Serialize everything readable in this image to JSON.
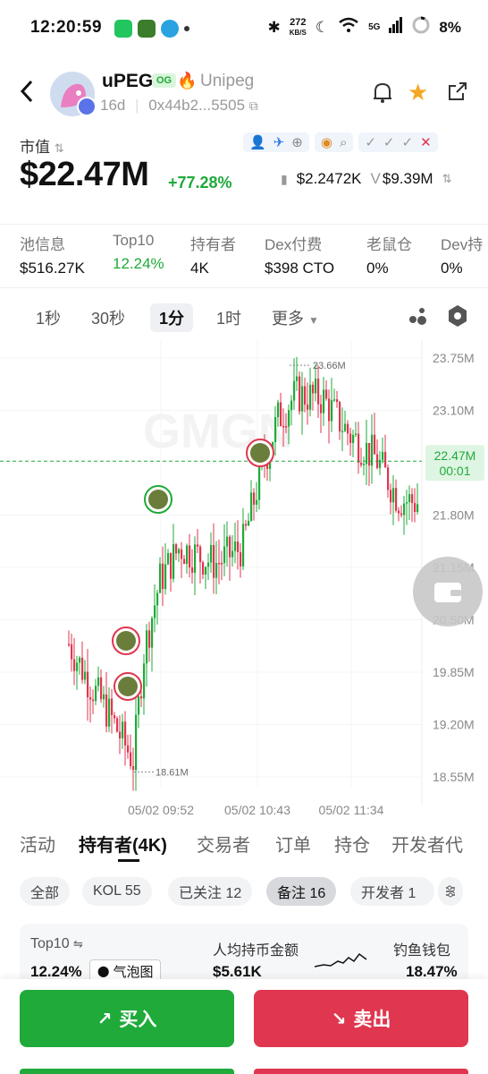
{
  "status": {
    "time": "12:20:59",
    "net_speed": "272",
    "net_unit": "KB/S",
    "battery": "8%",
    "net_type": "5G"
  },
  "header": {
    "name": "uPEG",
    "badge": "OG",
    "alias": "Unipeg",
    "age": "16d",
    "address": "0x44b2...5505"
  },
  "market": {
    "label": "市值",
    "value": "$22.47M",
    "change": "+77.28%",
    "price": "$2.2472K",
    "vol_prefix": "V",
    "volume": "$9.39M"
  },
  "stats": [
    {
      "label": "池信息",
      "value": "$516.27K"
    },
    {
      "label": "Top10",
      "value": "12.24%",
      "green": true
    },
    {
      "label": "持有者",
      "value": "4K"
    },
    {
      "label": "Dex付费",
      "value": "$398 CTO"
    },
    {
      "label": "老鼠仓",
      "value": "0%"
    },
    {
      "label": "Dev持",
      "value": "0%"
    }
  ],
  "timeframes": [
    "1秒",
    "30秒",
    "1分",
    "1时",
    "更多"
  ],
  "chart_data": {
    "type": "candlestick",
    "y_ticks": [
      "23.75M",
      "23.10M",
      "22.45M",
      "21.80M",
      "21.15M",
      "20.50M",
      "19.85M",
      "19.20M",
      "18.55M"
    ],
    "x_ticks": [
      "05/02 09:52",
      "05/02 10:43",
      "05/02 11:34"
    ],
    "current_price": "22.47M",
    "countdown": "00:01",
    "high_label": "23.66M",
    "low_label": "18.61M",
    "ylim": [
      18.55,
      23.75
    ],
    "colors": {
      "up": "#1faa3a",
      "down": "#e0364f"
    }
  },
  "tabs": [
    "活动",
    "持有者(4K)",
    "交易者",
    "订单",
    "持仓",
    "开发者代"
  ],
  "chips": [
    "全部",
    "KOL 55",
    "已关注 12",
    "备注 16",
    "开发者 1"
  ],
  "card": {
    "top10_label": "Top10",
    "top10_value": "12.24%",
    "bubble": "气泡图",
    "avg_label": "人均持币金额",
    "avg_value": "$5.61K",
    "fish_label": "钓鱼钱包",
    "fish_value": "18.47%"
  },
  "actions": {
    "buy": "买入",
    "sell": "卖出"
  }
}
